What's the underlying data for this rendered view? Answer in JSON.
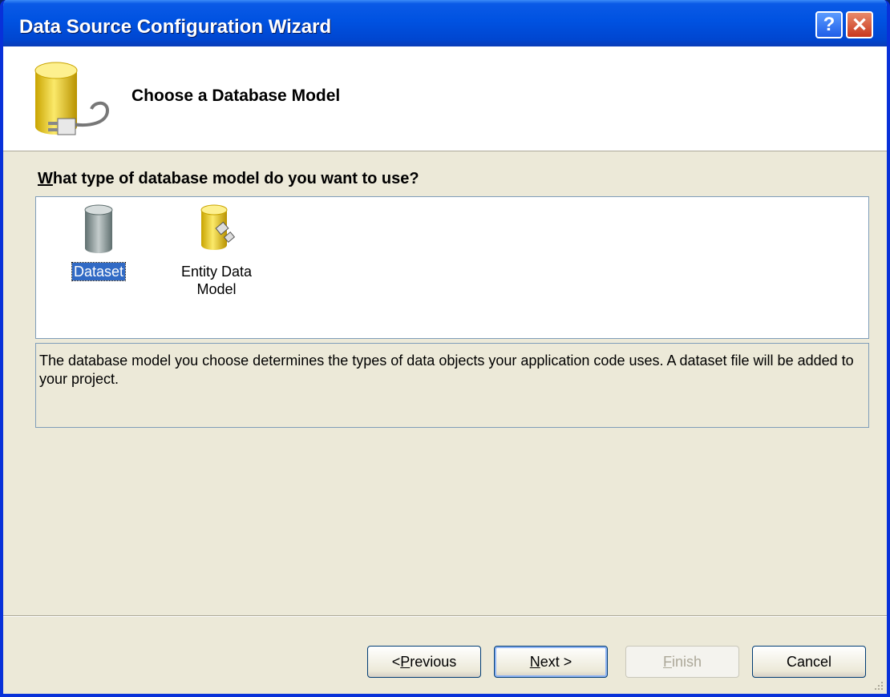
{
  "window": {
    "title": "Data Source Configuration Wizard",
    "help_glyph": "?",
    "close_glyph": "✕"
  },
  "header": {
    "title": "Choose a Database Model"
  },
  "question": {
    "accel": "W",
    "rest": "hat type of database model do you want to use?"
  },
  "models": [
    {
      "label": "Dataset",
      "selected": true,
      "icon": "dataset-icon"
    },
    {
      "label_line1": "Entity Data",
      "label_line2": "Model",
      "selected": false,
      "icon": "entity-data-model-icon"
    }
  ],
  "description": "The database model you choose determines the types of data objects your application code uses. A dataset file will be added to your project.",
  "buttons": {
    "previous_prefix": "< ",
    "previous_accel": "P",
    "previous_rest": "revious",
    "next_accel": "N",
    "next_rest": "ext >",
    "finish_accel": "F",
    "finish_rest": "inish",
    "cancel": "Cancel"
  },
  "colors": {
    "titlebar": "#0054e3",
    "selection": "#316ac5",
    "dialog_bg": "#ece9d8"
  }
}
